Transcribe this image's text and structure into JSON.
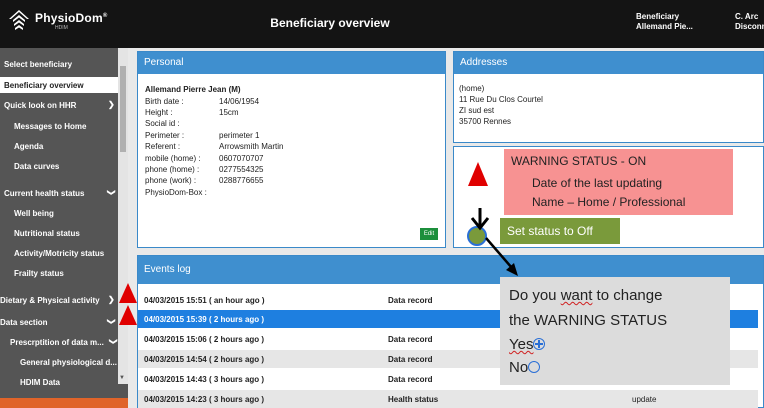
{
  "header": {
    "brand": "PhysioDom",
    "brand_mark": "®",
    "brand_sub": "HDIM",
    "title": "Beneficiary overview",
    "user_line1": "Beneficiary",
    "user_line2": "Allemand Pie...",
    "right_line1": "C. Arc",
    "right_line2": "Disconn"
  },
  "sidebar": {
    "items": [
      {
        "label": "Select beneficiary"
      },
      {
        "label": "Beneficiary overview"
      },
      {
        "label": "Quick look on HHR"
      },
      {
        "label": "Messages to Home"
      },
      {
        "label": "Agenda"
      },
      {
        "label": "Data curves"
      },
      {
        "label": "Current health status"
      },
      {
        "label": "Well being"
      },
      {
        "label": "Nutritional status"
      },
      {
        "label": "Activity/Motricity status"
      },
      {
        "label": "Frailty status"
      },
      {
        "label": "Dietary & Physical activity"
      },
      {
        "label": "Data section"
      },
      {
        "label": "Prescrptition of data m..."
      },
      {
        "label": "General physiological d..."
      },
      {
        "label": "HDIM Data"
      }
    ]
  },
  "personal": {
    "title": "Personal",
    "name": "Allemand Pierre Jean (M)",
    "rows": [
      {
        "label": "Birth date :",
        "value": "14/06/1954"
      },
      {
        "label": "Height :",
        "value": "15cm"
      },
      {
        "label": "Social id :",
        "value": ""
      },
      {
        "label": "Perimeter :",
        "value": "perimeter 1"
      },
      {
        "label": "Referent :",
        "value": "Arrowsmith Martin"
      },
      {
        "label": "mobile (home) :",
        "value": "0607070707"
      },
      {
        "label": "phone (home) :",
        "value": "0277554325"
      },
      {
        "label": "phone (work) :",
        "value": "0288776655"
      },
      {
        "label": "PhysioDom-Box :",
        "value": ""
      }
    ],
    "edit_label": "Edit"
  },
  "addresses": {
    "title": "Addresses",
    "lines": [
      "(home)",
      "11 Rue Du Clos Courtel",
      "ZI sud est",
      "35700 Rennes"
    ]
  },
  "warning": {
    "title": "WARNING STATUS - ON",
    "line2": "Date of the last updating",
    "line3": "Name – Home / Professional",
    "set_off_label": "Set status to Off"
  },
  "events": {
    "title": "Events log",
    "rows": [
      {
        "date": "04/03/2015 15:51 ( an hour ago )",
        "type": "Data record",
        "extra": ""
      },
      {
        "date": "04/03/2015 15:39 ( 2 hours ago )",
        "type": "",
        "extra": ""
      },
      {
        "date": "04/03/2015 15:06 ( 2 hours ago )",
        "type": "Data record",
        "extra": ""
      },
      {
        "date": "04/03/2015 14:54 ( 2 hours ago )",
        "type": "Data record",
        "extra": ""
      },
      {
        "date": "04/03/2015 14:43 ( 3 hours ago )",
        "type": "Data record",
        "extra": ""
      },
      {
        "date": "04/03/2015 14:23 ( 3 hours ago )",
        "type": "Health status",
        "extra": "update"
      }
    ]
  },
  "popup": {
    "line1_pre": "Do you ",
    "line1_word": "want",
    "line1_post": " to change",
    "line2": "the WARNING STATUS",
    "yes_label": "Yes",
    "no_label": "No"
  },
  "colors": {
    "header_bg": "#141414",
    "sidebar_bg": "#555555",
    "panel_head": "#3f8fcf",
    "highlight_row": "#1e7fe0",
    "warning_box": "#f79292",
    "set_off_btn": "#7a9a3b",
    "edit_btn": "#1c8f3c",
    "alert_red": "#e00000",
    "sidebar_bottom": "#e0642a"
  }
}
